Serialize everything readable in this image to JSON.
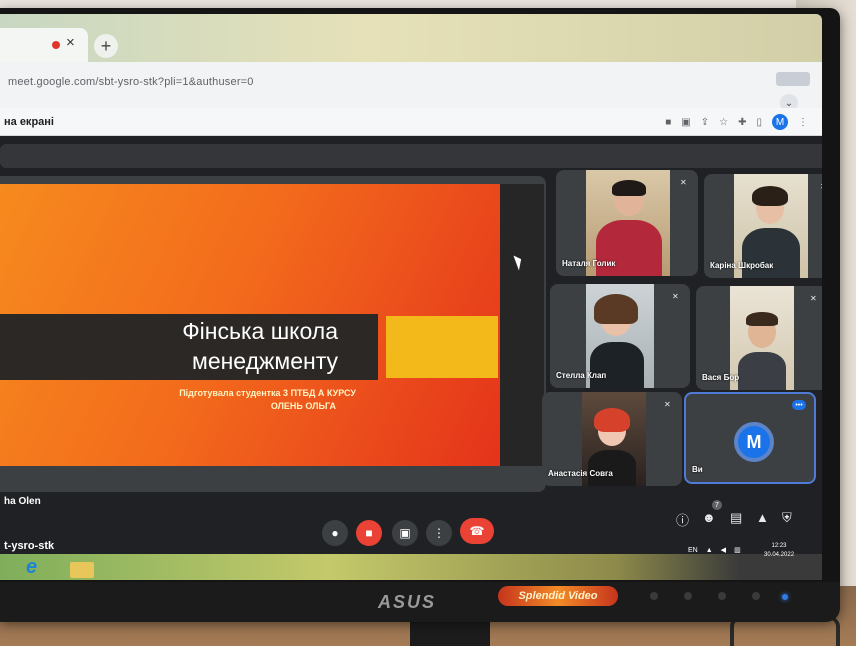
{
  "browser": {
    "tab_close": "×",
    "new_tab": "+",
    "url": "meet.google.com/sbt-ysro-stk?pli=1&authuser=0",
    "profile_initial": "M"
  },
  "meet": {
    "presenting_label": "на екрані",
    "presenter_name": "ha Olen",
    "meeting_code": "t-ysro-stk",
    "participants_badge": "7"
  },
  "slide": {
    "title_line1": "Фінська школа",
    "title_line2": "менеджменту",
    "subtitle_line1": "Підготувала студентка 3 ПТБД А КУРСУ",
    "subtitle_line2": "ОЛЕНЬ ОЛЬГА"
  },
  "participants": [
    {
      "name": "Наталя Голик",
      "muted": true
    },
    {
      "name": "Каріна Шкробак",
      "muted": true
    },
    {
      "name": "Стелла Клап",
      "muted": true
    },
    {
      "name": "Вася Бор",
      "muted": true
    },
    {
      "name": "Анастасія Совга",
      "muted": true
    },
    {
      "name": "Ви",
      "initial": "M",
      "speaking": true
    }
  ],
  "taskbar": {
    "language": "EN",
    "time": "12:23",
    "date": "30.04.2022"
  },
  "monitor": {
    "brand": "ASUS",
    "splendid": "Splendid Video"
  },
  "colors": {
    "meet_bg": "#202124",
    "tile_bg": "#3c4043",
    "end_call": "#ea4335",
    "accent_blue": "#1a73e8",
    "slide_orange": "#f36b1c",
    "slide_yellow": "#f3b81a"
  }
}
